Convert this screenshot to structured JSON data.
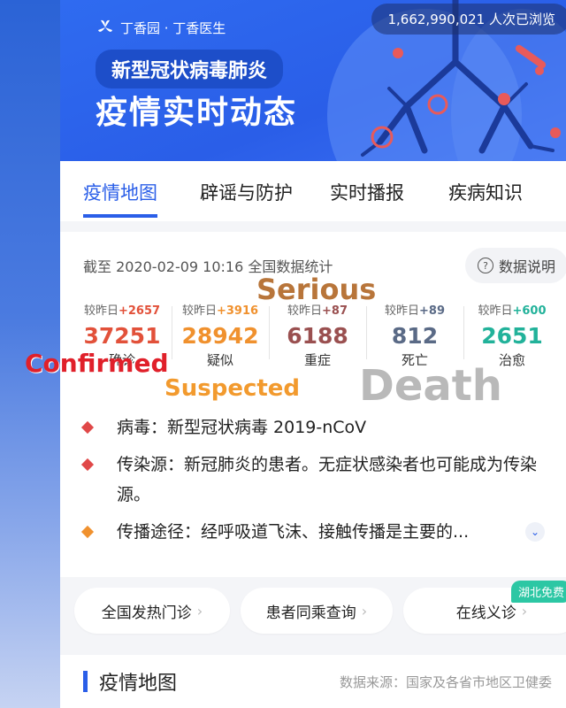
{
  "banner": {
    "brand": "丁香园 · 丁香医生",
    "tag_line1": "新型冠状病毒肺炎",
    "tag_line2": "疫情实时动态",
    "views": "1,662,990,021 人次已浏览",
    "brand_color": "#2a5ee8"
  },
  "tabs": [
    "疫情地图",
    "辟谣与防护",
    "实时播报",
    "疾病知识"
  ],
  "stats_card": {
    "as_of": "截至 2020-02-09 10:16 全国数据统计",
    "explain_label": "数据说明",
    "items": [
      {
        "delta_prefix": "较昨日",
        "delta": "+2657",
        "value": "37251",
        "label": "确诊",
        "color": "#e2513a"
      },
      {
        "delta_prefix": "较昨日",
        "delta": "+3916",
        "value": "28942",
        "label": "疑似",
        "color": "#f0912e"
      },
      {
        "delta_prefix": "较昨日",
        "delta": "+87",
        "value": "6188",
        "label": "重症",
        "color": "#9a5050"
      },
      {
        "delta_prefix": "较昨日",
        "delta": "+89",
        "value": "812",
        "label": "死亡",
        "color": "#5a6a86"
      },
      {
        "delta_prefix": "较昨日",
        "delta": "+600",
        "value": "2651",
        "label": "治愈",
        "color": "#22b29a"
      }
    ]
  },
  "annotations": {
    "confirmed": "Confirmed",
    "suspected": "Suspected",
    "serious": "Serious",
    "death": "Death"
  },
  "info": [
    {
      "text": "病毒：新型冠状病毒 2019-nCoV",
      "dot_color": "#e04848"
    },
    {
      "text": "传染源：新冠肺炎的患者。无症状感染者也可能成为传染源。",
      "dot_color": "#e04848"
    },
    {
      "text": "传播途径：经呼吸道飞沫、接触传播是主要的...",
      "dot_color": "#f0912e"
    }
  ],
  "buttons": [
    {
      "label": "全国发热门诊"
    },
    {
      "label": "患者同乘查询"
    },
    {
      "label": "在线义诊",
      "badge": "湖北免费"
    }
  ],
  "section": {
    "title": "疫情地图",
    "source": "数据来源：国家及各省市地区卫健委"
  }
}
